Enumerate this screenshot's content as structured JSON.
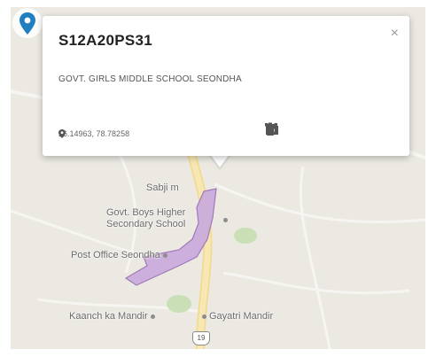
{
  "popup": {
    "title": "S12A20PS31",
    "description": "GOVT. GIRLS MIDDLE SCHOOL SEONDHA",
    "coordinates": "26.14963, 78.78258",
    "close_glyph": "×"
  },
  "map_labels": {
    "sabji": "Sabji m",
    "govt_boys_line1": "Govt. Boys Higher",
    "govt_boys_line2": "Secondary School",
    "post_office": "Post Office Seondha",
    "kaanch": "Kaanch ka Mandir",
    "gayatri": "Gayatri Mandir",
    "highway": "19"
  },
  "icons": {
    "coords": "location-pin-icon",
    "actions": [
      "paint-bucket-icon",
      "pencil-icon",
      "camera-icon",
      "route-icon",
      "trash-icon"
    ],
    "marker": "map-marker-icon"
  },
  "colors": {
    "marker": "#1f7fc0",
    "polygon_fill": "#c9a8db",
    "polygon_stroke": "#a07ab8",
    "road": "#f4e7b9",
    "park": "#c9dfb6"
  }
}
